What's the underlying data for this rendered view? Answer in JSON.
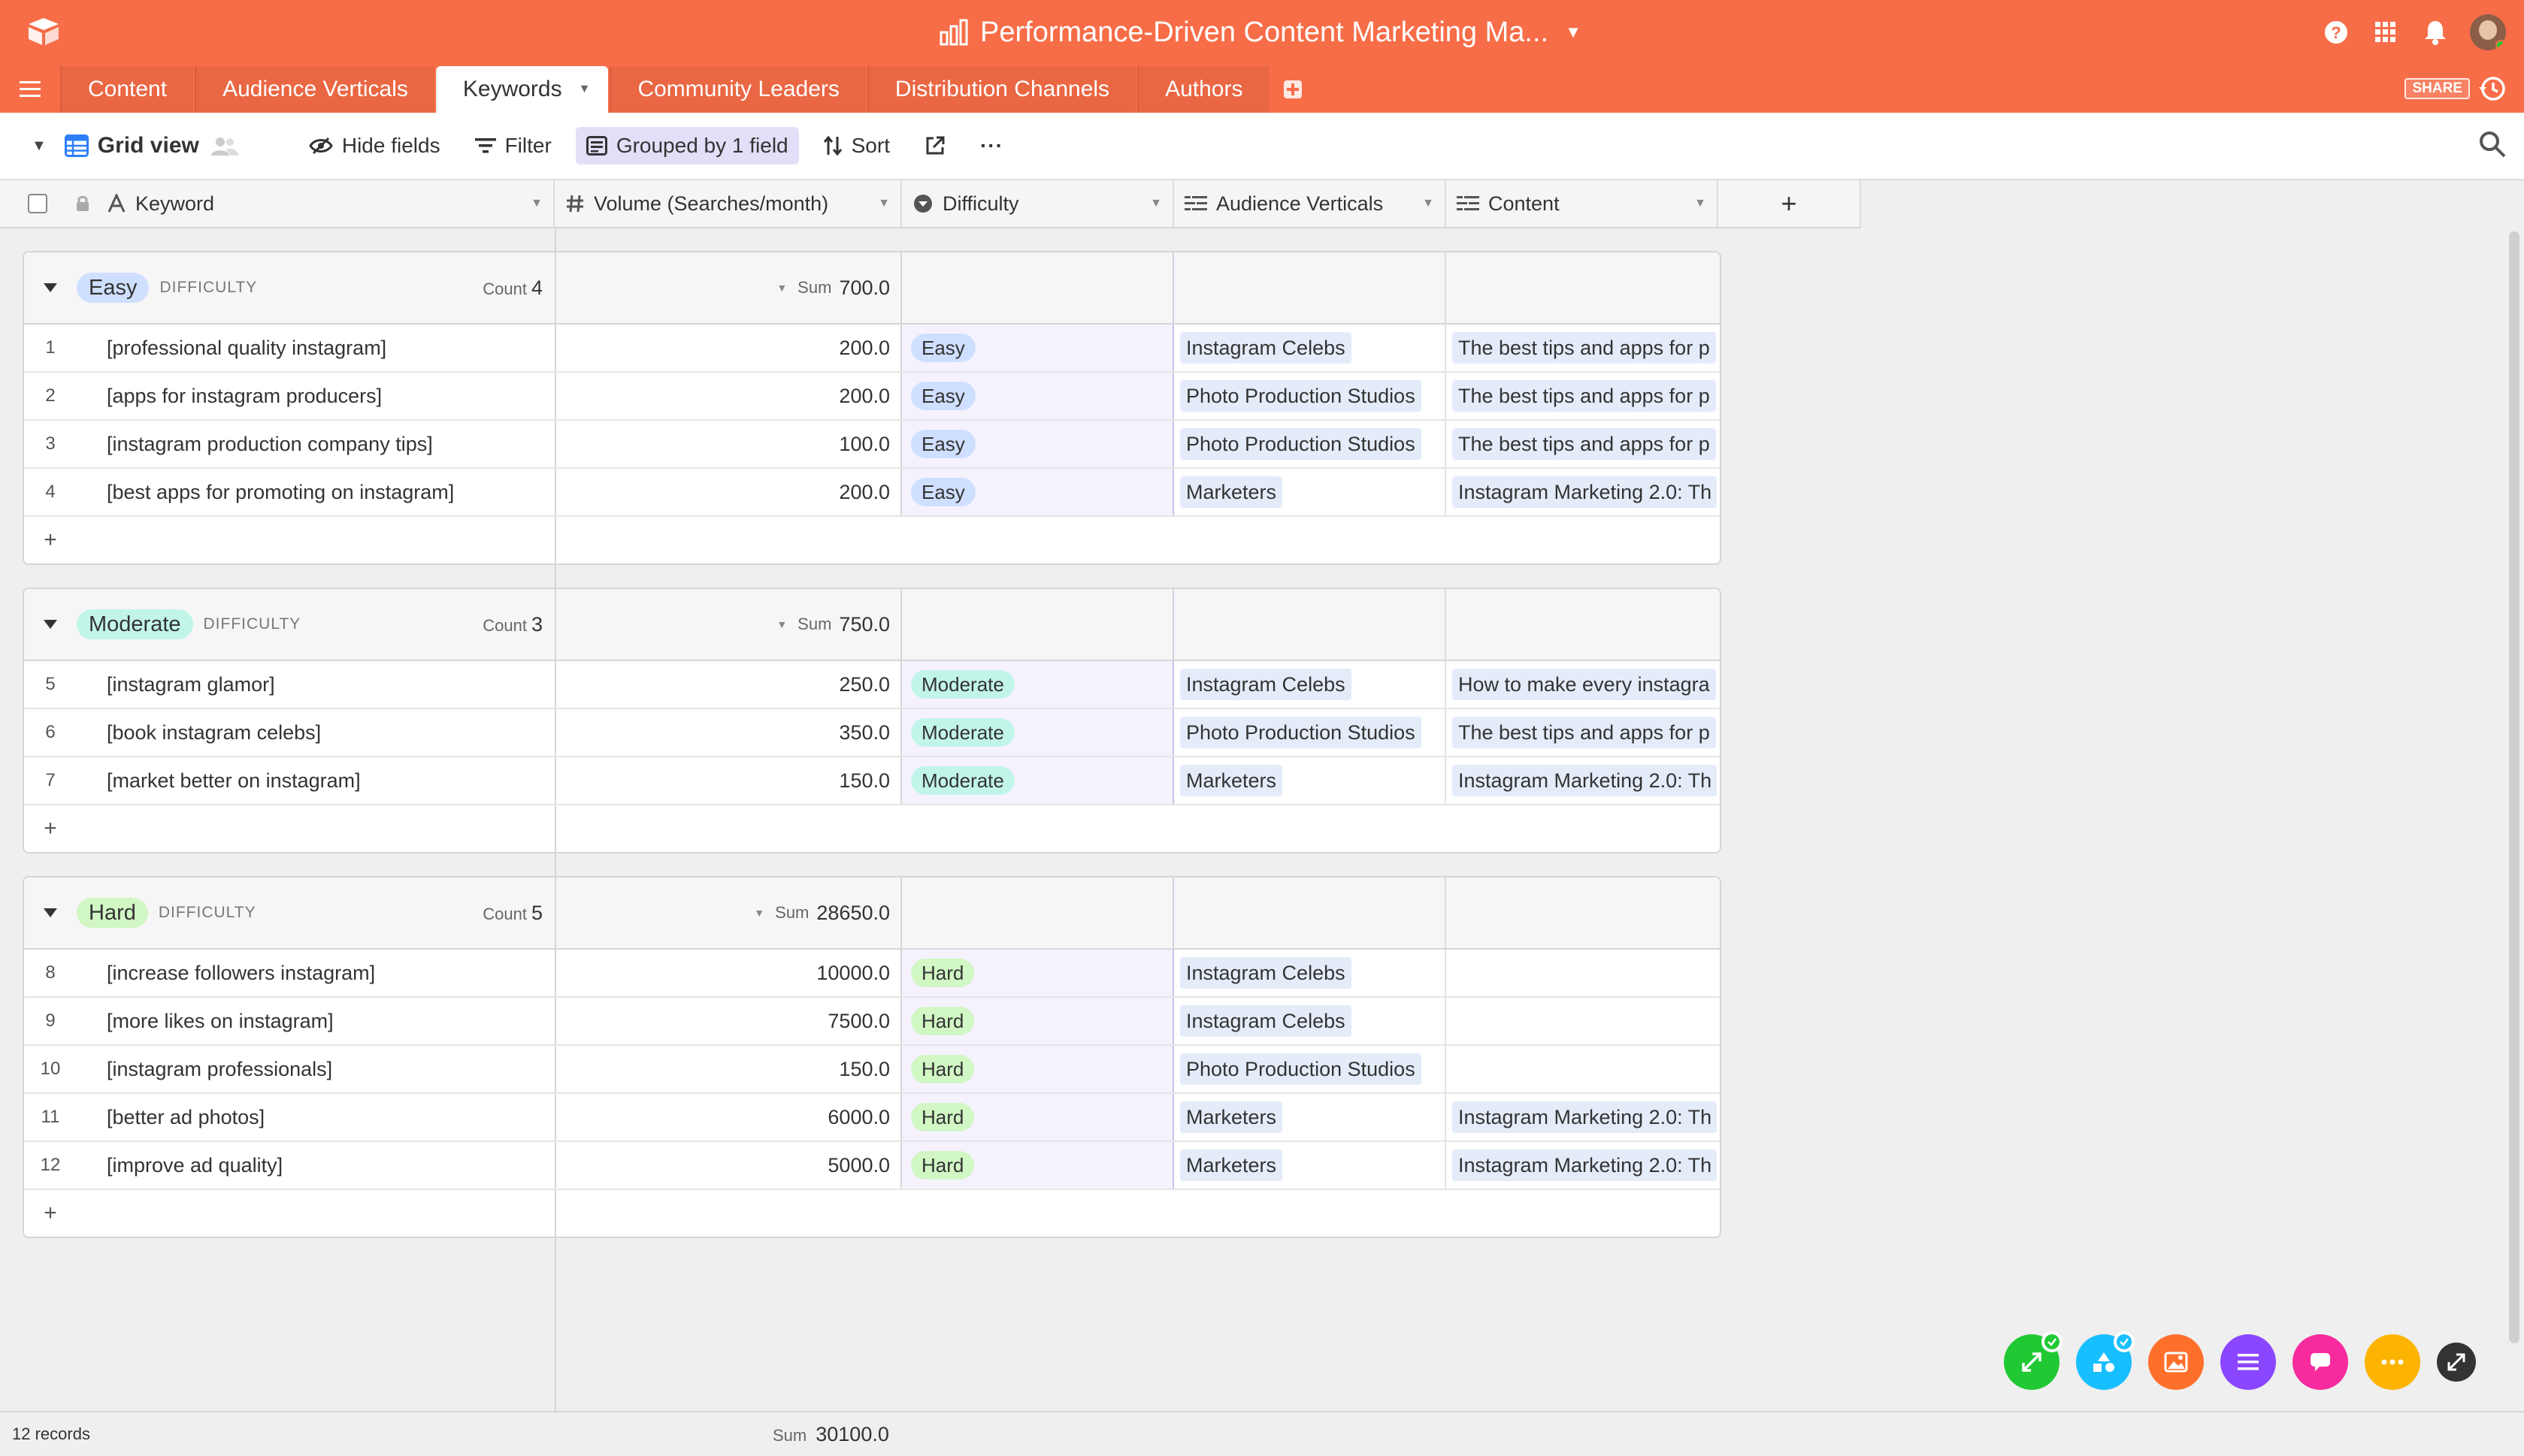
{
  "app": {
    "base_title": "Performance-Driven Content Marketing Ma...",
    "share_label": "SHARE"
  },
  "tabs": [
    {
      "label": "Content"
    },
    {
      "label": "Audience Verticals"
    },
    {
      "label": "Keywords"
    },
    {
      "label": "Community Leaders"
    },
    {
      "label": "Distribution Channels"
    },
    {
      "label": "Authors"
    }
  ],
  "toolbar": {
    "view_name": "Grid view",
    "hide_fields": "Hide fields",
    "filter": "Filter",
    "grouped": "Grouped by 1 field",
    "sort": "Sort",
    "more": "···"
  },
  "columns": {
    "keyword": "Keyword",
    "volume": "Volume (Searches/month)",
    "difficulty": "Difficulty",
    "audience": "Audience Verticals",
    "content": "Content",
    "add": "+"
  },
  "groups": [
    {
      "label": "Easy",
      "field": "DIFFICULTY",
      "count_label": "Count",
      "count": "4",
      "sum_label": "Sum",
      "sum": "700.0",
      "rows": [
        {
          "num": "1",
          "keyword": "[professional quality instagram]",
          "volume": "200.0",
          "difficulty": "Easy",
          "audience": "Instagram Celebs",
          "content": "The best tips and apps for p"
        },
        {
          "num": "2",
          "keyword": "[apps for instagram producers]",
          "volume": "200.0",
          "difficulty": "Easy",
          "audience": "Photo Production Studios",
          "content": "The best tips and apps for p"
        },
        {
          "num": "3",
          "keyword": "[instagram production company tips]",
          "volume": "100.0",
          "difficulty": "Easy",
          "audience": "Photo Production Studios",
          "content": "The best tips and apps for p"
        },
        {
          "num": "4",
          "keyword": "[best apps for promoting on instagram]",
          "volume": "200.0",
          "difficulty": "Easy",
          "audience": "Marketers",
          "content": "Instagram Marketing 2.0: Th"
        }
      ]
    },
    {
      "label": "Moderate",
      "field": "DIFFICULTY",
      "count_label": "Count",
      "count": "3",
      "sum_label": "Sum",
      "sum": "750.0",
      "rows": [
        {
          "num": "5",
          "keyword": "[instagram glamor]",
          "volume": "250.0",
          "difficulty": "Moderate",
          "audience": "Instagram Celebs",
          "content": "How to make every instagra"
        },
        {
          "num": "6",
          "keyword": "[book instagram celebs]",
          "volume": "350.0",
          "difficulty": "Moderate",
          "audience": "Photo Production Studios",
          "content": "The best tips and apps for p"
        },
        {
          "num": "7",
          "keyword": "[market better on instagram]",
          "volume": "150.0",
          "difficulty": "Moderate",
          "audience": "Marketers",
          "content": "Instagram Marketing 2.0: Th"
        }
      ]
    },
    {
      "label": "Hard",
      "field": "DIFFICULTY",
      "count_label": "Count",
      "count": "5",
      "sum_label": "Sum",
      "sum": "28650.0",
      "rows": [
        {
          "num": "8",
          "keyword": "[increase followers instagram]",
          "volume": "10000.0",
          "difficulty": "Hard",
          "audience": "Instagram Celebs",
          "content": ""
        },
        {
          "num": "9",
          "keyword": "[more likes on instagram]",
          "volume": "7500.0",
          "difficulty": "Hard",
          "audience": "Instagram Celebs",
          "content": ""
        },
        {
          "num": "10",
          "keyword": "[instagram professionals]",
          "volume": "150.0",
          "difficulty": "Hard",
          "audience": "Photo Production Studios",
          "content": ""
        },
        {
          "num": "11",
          "keyword": "[better ad photos]",
          "volume": "6000.0",
          "difficulty": "Hard",
          "audience": "Marketers",
          "content": "Instagram Marketing 2.0: Th"
        },
        {
          "num": "12",
          "keyword": "[improve ad quality]",
          "volume": "5000.0",
          "difficulty": "Hard",
          "audience": "Marketers",
          "content": "Instagram Marketing 2.0: Th"
        }
      ]
    }
  ],
  "add_row_label": "+",
  "footer": {
    "records": "12 records",
    "sum_label": "Sum",
    "sum": "30100.0"
  },
  "colors": {
    "brand": "#f76d48",
    "easy": "#cfdfff",
    "moderate": "#c2f5e9",
    "hard": "#d1f7c4",
    "link_chip": "#e4ecfa"
  },
  "apps": [
    {
      "icon": "expand-arrows-icon",
      "color": "#20c933",
      "checked": true
    },
    {
      "icon": "shapes-icon",
      "color": "#18bfff",
      "checked": true
    },
    {
      "icon": "image-icon",
      "color": "#ff6f2c",
      "checked": false
    },
    {
      "icon": "list-icon",
      "color": "#8b46ff",
      "checked": false
    },
    {
      "icon": "chat-icon",
      "color": "#f82b9e",
      "checked": false
    },
    {
      "icon": "more-icon",
      "color": "#fcb400",
      "checked": false
    },
    {
      "icon": "fullscreen-icon",
      "color": "#333333",
      "checked": false
    }
  ]
}
